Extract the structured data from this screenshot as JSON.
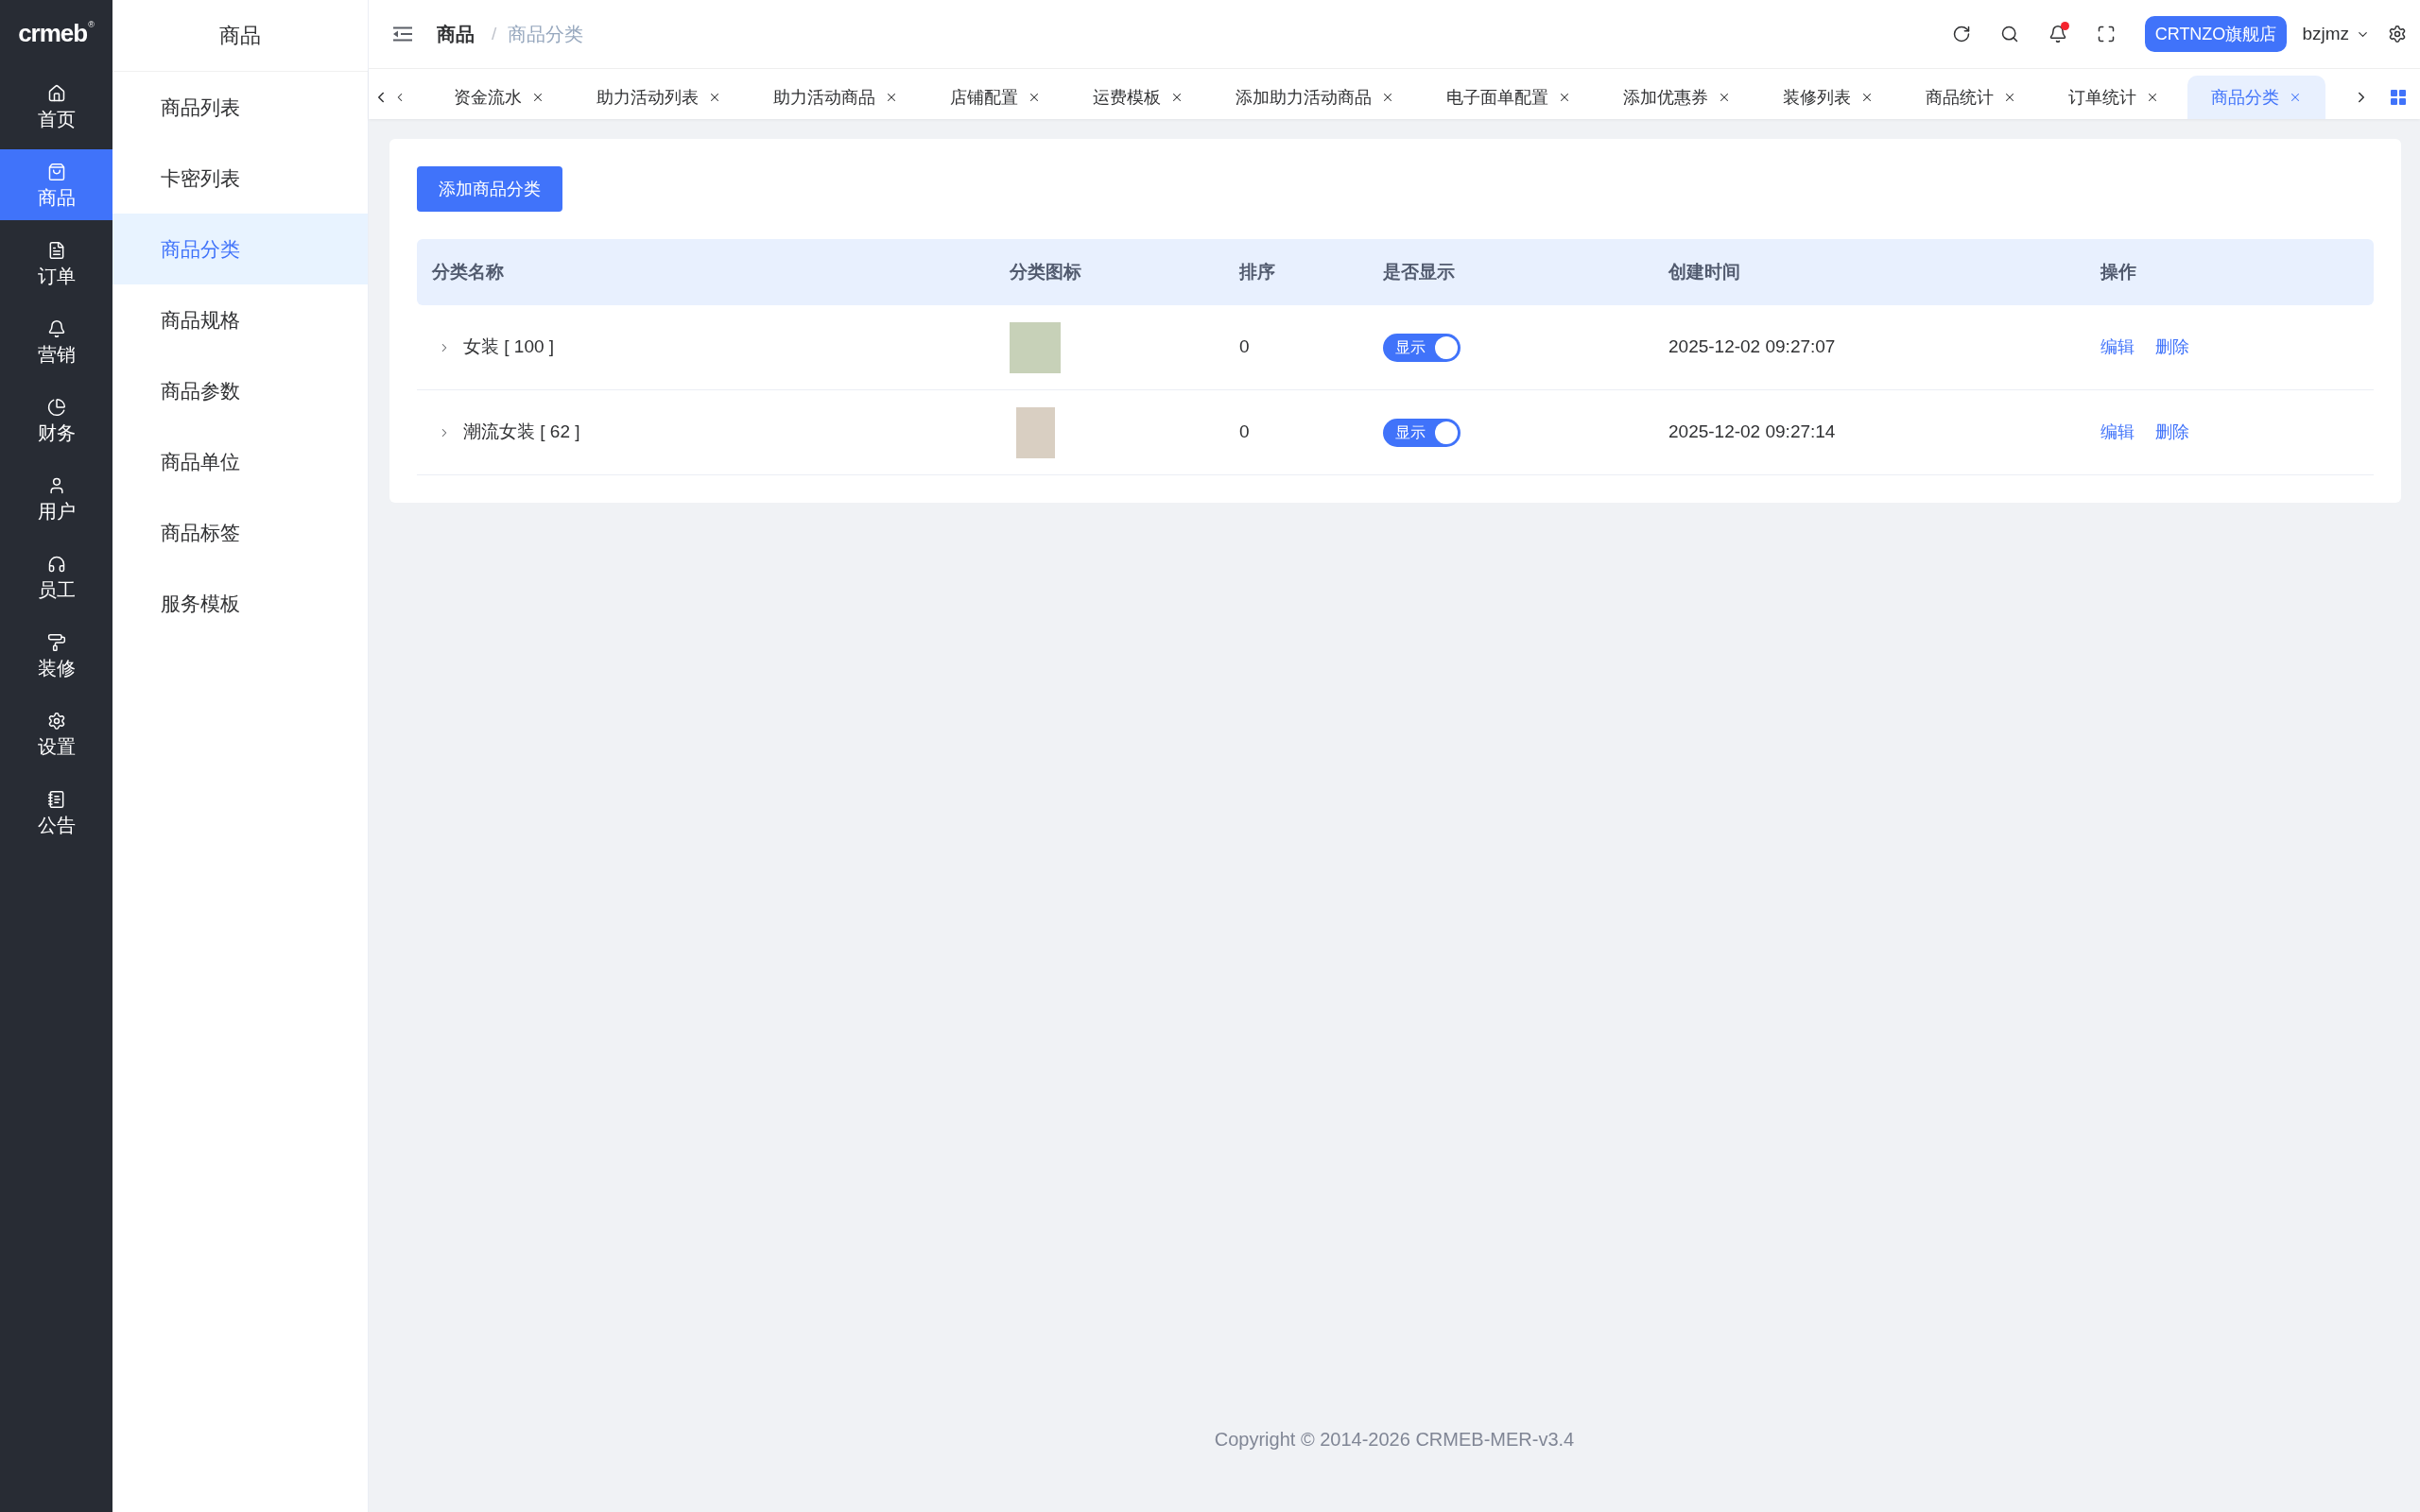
{
  "logo": {
    "text": "crmeb",
    "mark": "®"
  },
  "main_menu": [
    {
      "label": "首页",
      "selected": false
    },
    {
      "label": "商品",
      "selected": true
    },
    {
      "label": "订单",
      "selected": false
    },
    {
      "label": "营销",
      "selected": false
    },
    {
      "label": "财务",
      "selected": false
    },
    {
      "label": "用户",
      "selected": false
    },
    {
      "label": "员工",
      "selected": false
    },
    {
      "label": "装修",
      "selected": false
    },
    {
      "label": "设置",
      "selected": false
    },
    {
      "label": "公告",
      "selected": false
    }
  ],
  "sub_menu": {
    "title": "商品",
    "items": [
      {
        "label": "商品列表",
        "selected": false
      },
      {
        "label": "卡密列表",
        "selected": false
      },
      {
        "label": "商品分类",
        "selected": true
      },
      {
        "label": "商品规格",
        "selected": false
      },
      {
        "label": "商品参数",
        "selected": false
      },
      {
        "label": "商品单位",
        "selected": false
      },
      {
        "label": "商品标签",
        "selected": false
      },
      {
        "label": "服务模板",
        "selected": false
      }
    ]
  },
  "header": {
    "breadcrumb": [
      {
        "label": "商品"
      },
      {
        "label": "商品分类"
      }
    ],
    "separator": "/",
    "unread": true,
    "store_button": "CRTNZO旗舰店",
    "user": "bzjmz"
  },
  "tabs": [
    {
      "label": "资金流水",
      "selected": false
    },
    {
      "label": "助力活动列表",
      "selected": false
    },
    {
      "label": "助力活动商品",
      "selected": false
    },
    {
      "label": "店铺配置",
      "selected": false
    },
    {
      "label": "运费模板",
      "selected": false
    },
    {
      "label": "添加助力活动商品",
      "selected": false
    },
    {
      "label": "电子面单配置",
      "selected": false
    },
    {
      "label": "添加优惠券",
      "selected": false
    },
    {
      "label": "装修列表",
      "selected": false
    },
    {
      "label": "商品统计",
      "selected": false
    },
    {
      "label": "订单统计",
      "selected": false
    },
    {
      "label": "商品分类",
      "selected": true
    }
  ],
  "page": {
    "add_button": "添加商品分类"
  },
  "table": {
    "columns": [
      "分类名称",
      "分类图标",
      "排序",
      "是否显示",
      "创建时间",
      "操作"
    ],
    "rows": [
      {
        "name": "女装 [ 100 ]",
        "expanded": false,
        "sort": "0",
        "show": {
          "on": true,
          "label": "显示"
        },
        "created": "2025-12-02 09:27:07",
        "actions": [
          "编辑",
          "删除"
        ]
      },
      {
        "name": "潮流女装 [ 62 ]",
        "expanded": false,
        "sort": "0",
        "show": {
          "on": true,
          "label": "显示"
        },
        "created": "2025-12-02 09:27:14",
        "actions": [
          "编辑",
          "删除"
        ]
      }
    ]
  },
  "footer": {
    "copyright": "Copyright © 2014-2026 CRMEB-MER-v3.4"
  }
}
